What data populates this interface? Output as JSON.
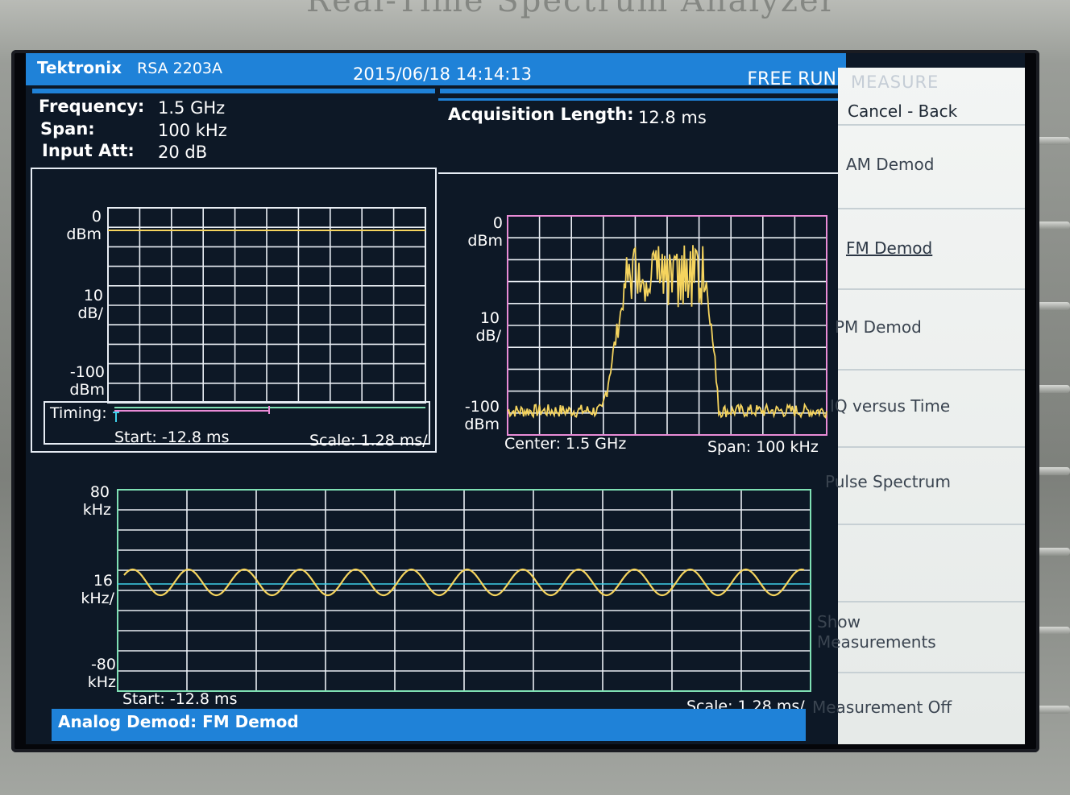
{
  "bezel": {
    "title_partial": "Real-Time Spectrum Analyzer"
  },
  "header": {
    "brand": "Tektronix",
    "model": "RSA 2203A",
    "datetime": "2015/06/18 14:14:13",
    "run_mode": "FREE RUN"
  },
  "settings": {
    "frequency_label": "Frequency:",
    "frequency_value": "1.5 GHz",
    "span_label": "Span:",
    "span_value": "100 kHz",
    "input_att_label": "Input Att:",
    "input_att_value": "20 dB",
    "acq_length_label": "Acquisition Length:",
    "acq_length_value": "12.8 ms"
  },
  "power_vs_time": {
    "top_val": "0",
    "top_unit": "dBm",
    "scale_val": "10",
    "scale_unit": "dB/",
    "bottom_val": "-100",
    "bottom_unit": "dBm",
    "timing_label": "Timing:",
    "start": "Start: -12.8 ms",
    "scale": "Scale: 1.28 ms/"
  },
  "spectrum": {
    "top_val": "0",
    "top_unit": "dBm",
    "scale_val": "10",
    "scale_unit": "dB/",
    "bottom_val": "-100",
    "bottom_unit": "dBm",
    "center": "Center: 1.5 GHz",
    "span": "Span: 100 kHz"
  },
  "fm_demod": {
    "top_val": "80",
    "top_unit": "kHz",
    "scale_val": "16",
    "scale_unit": "kHz/",
    "bottom_val": "-80",
    "bottom_unit": "kHz",
    "start": "Start: -12.8 ms",
    "scale": "Scale: 1.28 ms/"
  },
  "menu": {
    "title": "MEASURE",
    "items": [
      "Cancel - Back",
      "AM Demod",
      "FM Demod",
      "PM Demod",
      "IQ versus Time",
      "Pulse Spectrum",
      "",
      "Show Measurements",
      "Measurement Off"
    ]
  },
  "status": {
    "text": "Analog Demod: FM Demod"
  },
  "colors": {
    "trace": "#f5d45e",
    "grid": "#e9eef4",
    "accent_blue": "#1f82d8",
    "pink_frame": "#e98bd6",
    "green_frame": "#7fe0b4",
    "cyan_ref": "#3fd0ea"
  }
}
